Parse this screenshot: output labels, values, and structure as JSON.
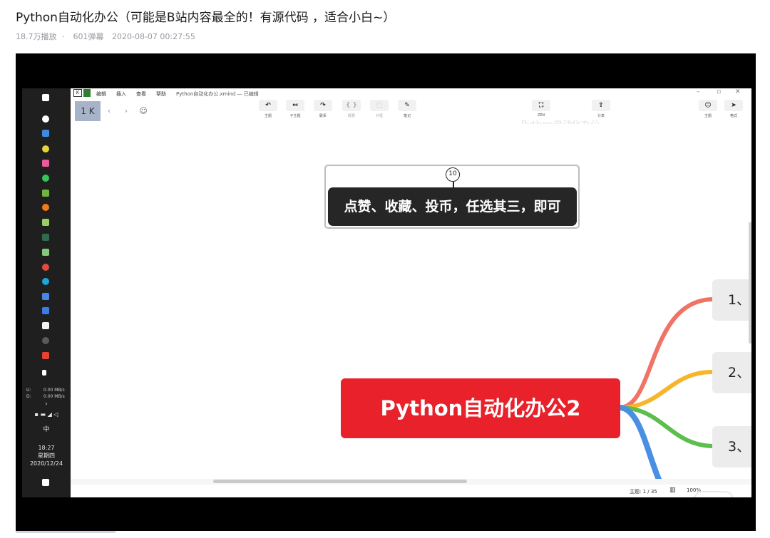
{
  "video": {
    "title": "Python自动化办公（可能是B站内容最全的！有源代码 ，适合小白~）",
    "views": "18.7万播放",
    "danmaku": "601弹幕",
    "datetime": "2020-08-07 00:27:55"
  },
  "taskbar": {
    "net_up_label": "U:",
    "net_up": "0.00 MB/s",
    "net_down_label": "D:",
    "net_down": "0.00 MB/s",
    "ime": "中",
    "time": "18:27",
    "weekday": "星期四",
    "date": "2020/12/24"
  },
  "app": {
    "menu": [
      "编辑",
      "插入",
      "查看",
      "帮助"
    ],
    "file_title": "Python自动化办公.xmind — 已编辑",
    "tab_label": "1 K",
    "tools": [
      {
        "icon": "undo-topic-icon",
        "glyph": "↶",
        "label": "主题"
      },
      {
        "icon": "subtopic-icon",
        "glyph": "↤",
        "label": "子主题"
      },
      {
        "icon": "relationship-icon",
        "glyph": "↷",
        "label": "联系"
      },
      {
        "icon": "summary-icon",
        "glyph": "{ }",
        "label": "概要"
      },
      {
        "icon": "boundary-icon",
        "glyph": "⬚",
        "label": "外框"
      },
      {
        "icon": "note-icon",
        "glyph": "✎",
        "label": "笔记"
      }
    ],
    "right_tools": [
      {
        "icon": "zen-mode-icon",
        "glyph": "⛶",
        "label": "ZEN"
      },
      {
        "icon": "share-icon",
        "glyph": "⇪",
        "label": "分享"
      }
    ],
    "panel_tools": [
      {
        "icon": "format-icon",
        "glyph": "☺",
        "label": "主题"
      },
      {
        "icon": "style-icon",
        "glyph": "➤",
        "label": "格式"
      }
    ],
    "watermark": "Python自动化办公"
  },
  "mindmap": {
    "callout_number": "10",
    "callout_text": "点赞、收藏、投币，任选其三，即可",
    "root": "Python自动化办公2",
    "branches": [
      "1、",
      "2、",
      "3、"
    ],
    "branch_colors": [
      "#f07466",
      "#f7b52c",
      "#5cbf4d",
      "#4a90e2"
    ]
  },
  "status": {
    "topic_count": "主题: 1 / 35",
    "zoom": "100%"
  }
}
